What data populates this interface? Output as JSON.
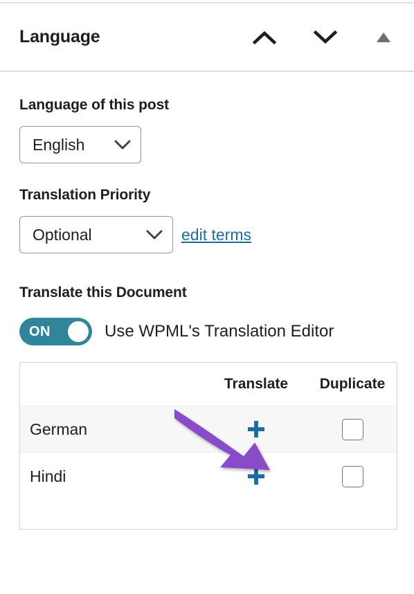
{
  "panel": {
    "title": "Language",
    "header_icons": [
      {
        "name": "chevron-up-icon",
        "glyph": "∧"
      },
      {
        "name": "chevron-down-icon",
        "glyph": "∨"
      },
      {
        "name": "collapse-triangle-icon",
        "glyph": "▲"
      }
    ]
  },
  "language_of_post": {
    "label": "Language of this post",
    "selected": "English"
  },
  "translation_priority": {
    "label": "Translation Priority",
    "selected": "Optional",
    "edit_link": "edit terms"
  },
  "translate_document": {
    "label": "Translate this Document",
    "toggle": {
      "state_text": "ON",
      "caption": "Use WPML's Translation Editor",
      "on_color": "#31859b"
    },
    "table": {
      "columns": [
        "",
        "Translate",
        "Duplicate"
      ],
      "rows": [
        {
          "language": "German",
          "translate": "+",
          "duplicate_checked": false
        },
        {
          "language": "Hindi",
          "translate": "+",
          "duplicate_checked": false
        }
      ]
    }
  },
  "annotation": {
    "type": "arrow",
    "color": "#8a4bc9",
    "points_at": "german-translate-plus-button"
  },
  "colors": {
    "link": "#1d6d96",
    "plus": "#1a6b9e",
    "toggle_on": "#31859b",
    "arrow": "#8a4bc9",
    "text": "#1e1e1e",
    "border": "#d0d0d0"
  }
}
